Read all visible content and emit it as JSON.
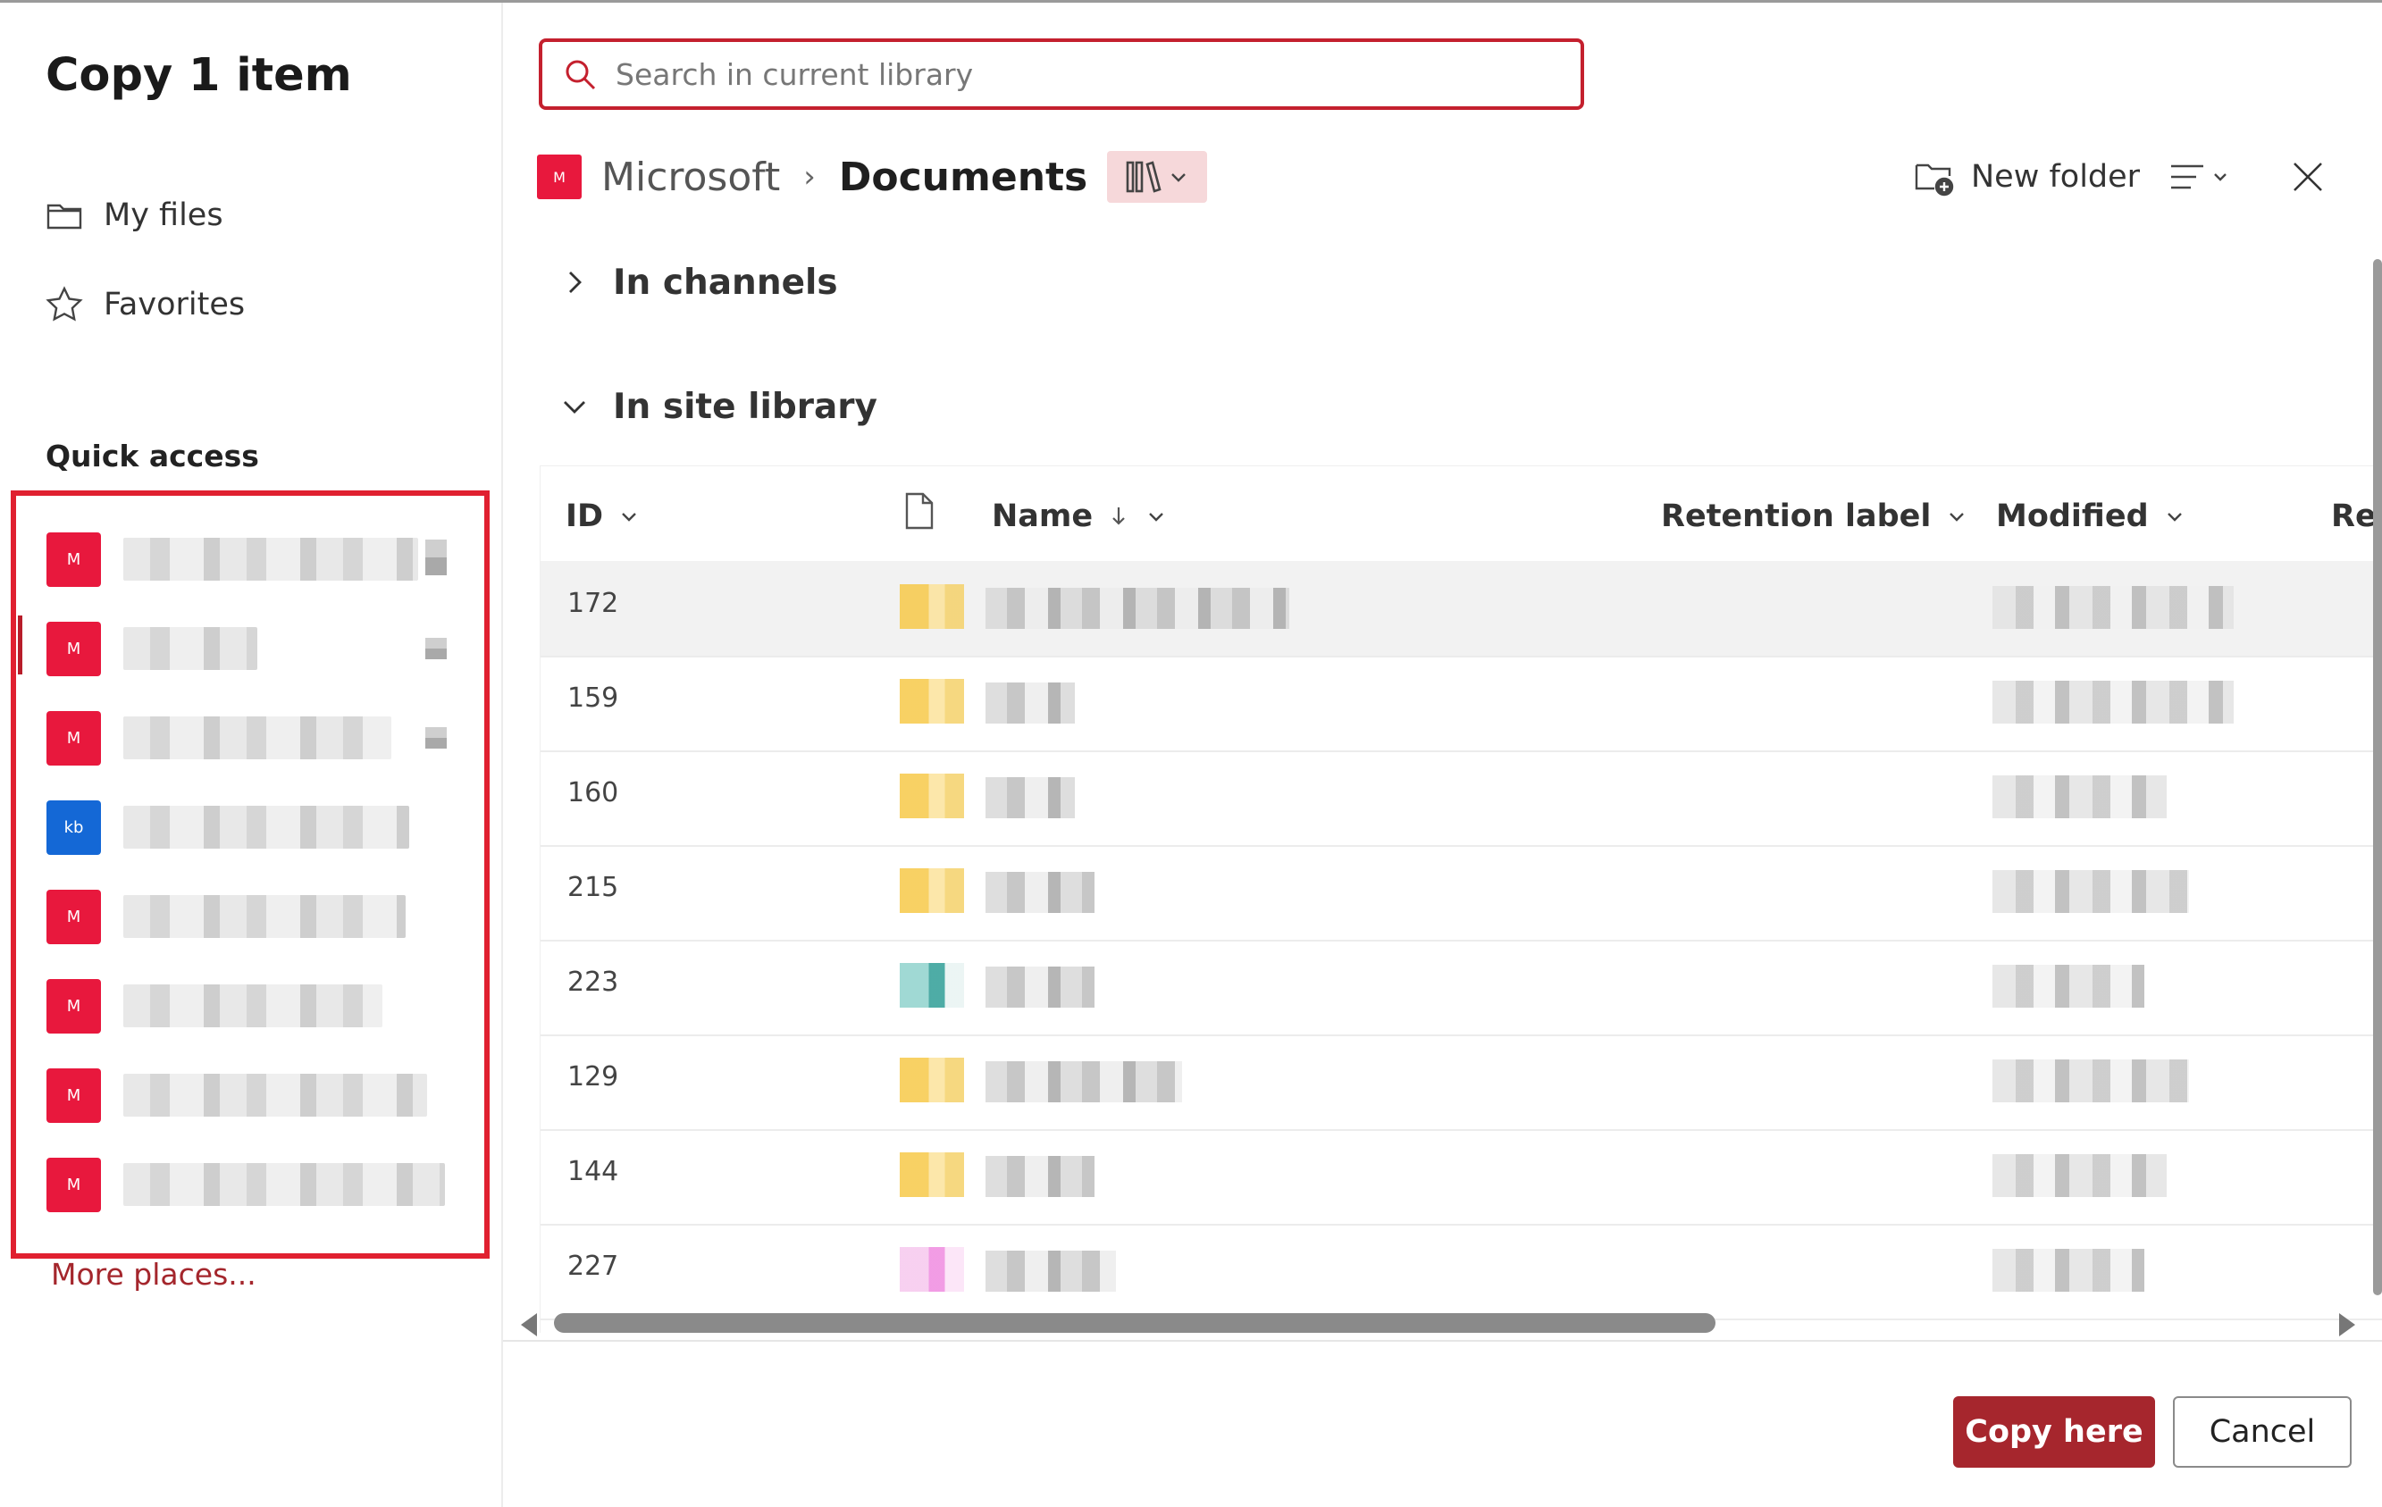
{
  "dialog": {
    "title": "Copy 1 item"
  },
  "sidebar": {
    "nav": [
      {
        "label": "My files",
        "icon": "folder-icon"
      },
      {
        "label": "Favorites",
        "icon": "star-icon"
      }
    ],
    "quick_access_title": "Quick access",
    "quick_access_items": [
      {
        "site_badge": "M",
        "color": "#e8183d"
      },
      {
        "site_badge": "M",
        "color": "#e8183d"
      },
      {
        "site_badge": "M",
        "color": "#e8183d"
      },
      {
        "site_badge": "kb",
        "color": "#1468d6"
      },
      {
        "site_badge": "M",
        "color": "#e8183d"
      },
      {
        "site_badge": "M",
        "color": "#e8183d"
      },
      {
        "site_badge": "M",
        "color": "#e8183d"
      },
      {
        "site_badge": "M",
        "color": "#e8183d"
      }
    ],
    "more_places": "More places..."
  },
  "search": {
    "placeholder": "Search in current library"
  },
  "breadcrumb": {
    "site_badge": "M",
    "site": "Microsoft",
    "library": "Documents"
  },
  "toolbar": {
    "new_folder": "New folder"
  },
  "sections": {
    "channels": "In channels",
    "site_library": "In site library"
  },
  "table": {
    "columns": {
      "id": "ID",
      "name": "Name",
      "retention": "Retention label",
      "modified": "Modified",
      "more": "Ret"
    },
    "rows": [
      {
        "id": "172"
      },
      {
        "id": "159"
      },
      {
        "id": "160"
      },
      {
        "id": "215"
      },
      {
        "id": "223"
      },
      {
        "id": "129"
      },
      {
        "id": "144"
      },
      {
        "id": "227"
      }
    ]
  },
  "footer": {
    "copy_here": "Copy here",
    "cancel": "Cancel"
  },
  "colors": {
    "accent": "#a6262d",
    "site_red": "#e8183d",
    "site_blue": "#1468d6",
    "highlight_border": "#e02030"
  }
}
